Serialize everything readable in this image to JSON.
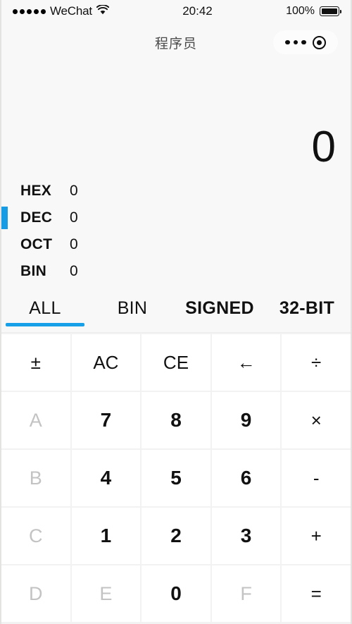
{
  "statusbar": {
    "carrier": "WeChat",
    "signal_icon": "signal-dots-icon",
    "wifi_icon": "wifi-icon",
    "time": "20:42",
    "battery_percent": "100%",
    "battery_icon": "battery-full-icon"
  },
  "navbar": {
    "title": "程序员",
    "menu_icon": "more-dots-icon",
    "target_icon": "target-circle-icon"
  },
  "display": {
    "value": "0"
  },
  "bases": [
    {
      "label": "HEX",
      "value": "0",
      "active": false
    },
    {
      "label": "DEC",
      "value": "0",
      "active": true
    },
    {
      "label": "OCT",
      "value": "0",
      "active": false
    },
    {
      "label": "BIN",
      "value": "0",
      "active": false
    }
  ],
  "tabs": [
    {
      "label": "ALL",
      "active": true,
      "bold": false
    },
    {
      "label": "BIN",
      "active": false,
      "bold": false
    },
    {
      "label": "SIGNED",
      "active": false,
      "bold": true
    },
    {
      "label": "32-BIT",
      "active": false,
      "bold": true
    }
  ],
  "keypad": [
    {
      "label": "±",
      "kind": "fn",
      "name": "key-plus-minus"
    },
    {
      "label": "AC",
      "kind": "fn",
      "name": "key-all-clear"
    },
    {
      "label": "CE",
      "kind": "fn",
      "name": "key-clear-entry"
    },
    {
      "label": "←",
      "kind": "fn",
      "name": "key-backspace"
    },
    {
      "label": "÷",
      "kind": "op",
      "name": "key-divide"
    },
    {
      "label": "A",
      "kind": "dim",
      "name": "key-hex-a"
    },
    {
      "label": "7",
      "kind": "num",
      "name": "key-7"
    },
    {
      "label": "8",
      "kind": "num",
      "name": "key-8"
    },
    {
      "label": "9",
      "kind": "num",
      "name": "key-9"
    },
    {
      "label": "×",
      "kind": "op",
      "name": "key-multiply"
    },
    {
      "label": "B",
      "kind": "dim",
      "name": "key-hex-b"
    },
    {
      "label": "4",
      "kind": "num",
      "name": "key-4"
    },
    {
      "label": "5",
      "kind": "num",
      "name": "key-5"
    },
    {
      "label": "6",
      "kind": "num",
      "name": "key-6"
    },
    {
      "label": "-",
      "kind": "op",
      "name": "key-subtract"
    },
    {
      "label": "C",
      "kind": "dim",
      "name": "key-hex-c"
    },
    {
      "label": "1",
      "kind": "num",
      "name": "key-1"
    },
    {
      "label": "2",
      "kind": "num",
      "name": "key-2"
    },
    {
      "label": "3",
      "kind": "num",
      "name": "key-3"
    },
    {
      "label": "+",
      "kind": "op",
      "name": "key-add"
    },
    {
      "label": "D",
      "kind": "dim",
      "name": "key-hex-d"
    },
    {
      "label": "E",
      "kind": "dim",
      "name": "key-hex-e"
    },
    {
      "label": "0",
      "kind": "num",
      "name": "key-0"
    },
    {
      "label": "F",
      "kind": "dim",
      "name": "key-hex-f"
    },
    {
      "label": "=",
      "kind": "op",
      "name": "key-equals"
    }
  ],
  "colors": {
    "accent": "#159ce4",
    "tab_accent": "#17a0e8",
    "background": "#f8f8f8",
    "key_bg": "#ffffff",
    "dim_text": "#c3c3c3"
  }
}
